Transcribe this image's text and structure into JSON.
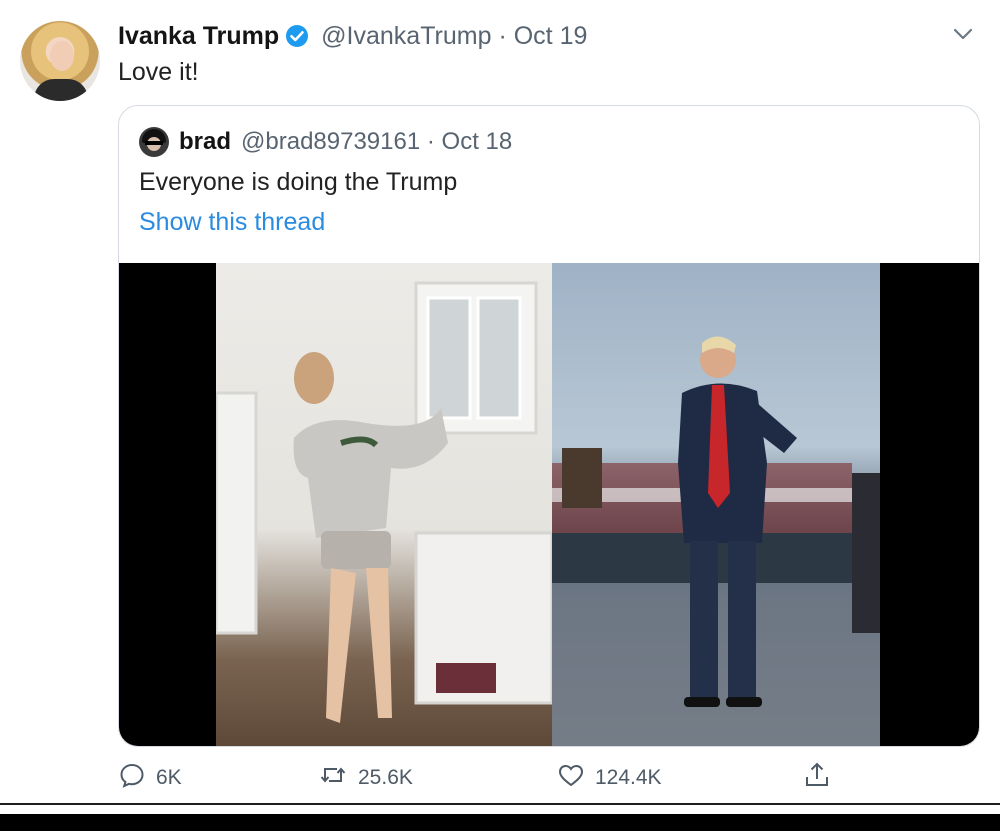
{
  "tweet": {
    "display_name": "Ivanka Trump",
    "handle_date": "@IvankaTrump · Oct 19",
    "text": "Love it!"
  },
  "quoted_tweet": {
    "display_name": "brad",
    "handle_date": "@brad89739161 · Oct 18",
    "text": "Everyone is doing the Trump",
    "show_thread": "Show this thread"
  },
  "actions": {
    "reply_count": "6K",
    "retweet_count": "25.6K",
    "like_count": "124.4K"
  },
  "colors": {
    "link": "#2a8be0",
    "verified": "#1d9bf0",
    "secondary_text": "#586471"
  },
  "icons": [
    "verified-badge-icon",
    "chevron-down-icon",
    "reply-icon",
    "retweet-icon",
    "like-icon",
    "share-icon"
  ]
}
